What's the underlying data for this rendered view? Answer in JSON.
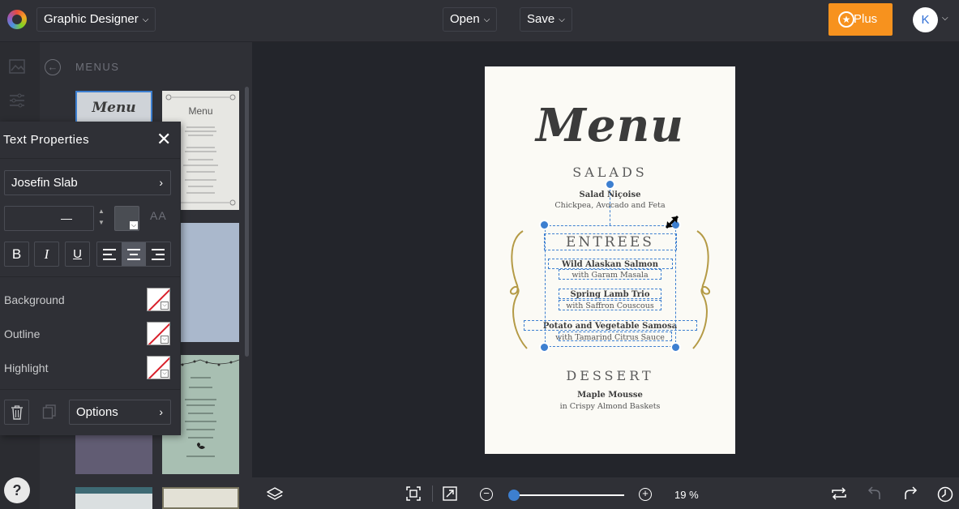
{
  "header": {
    "app_mode": "Graphic Designer",
    "open_label": "Open",
    "save_label": "Save",
    "plus_label": "Plus",
    "avatar_initial": "K"
  },
  "panel": {
    "title": "MENUS"
  },
  "text_properties": {
    "title": "Text Properties",
    "font": "Josefin Slab",
    "font_size": "—",
    "aa_label": "AA",
    "bold": "B",
    "italic": "I",
    "underline": "U",
    "background_label": "Background",
    "outline_label": "Outline",
    "highlight_label": "Highlight",
    "options_label": "Options"
  },
  "menu_design": {
    "title": "Menu",
    "salads_heading": "SALADS",
    "salad_item": "Salad Niçoise",
    "salad_desc": "Chickpea, Avocado and Feta",
    "entrees_heading": "ENTREES",
    "entree1": "Wild Alaskan Salmon",
    "entree1_desc": "with Garam Masala",
    "entree2": "Spring Lamb Trio",
    "entree2_desc": "with Saffron Couscous",
    "entree3": "Potato and Vegetable Samosa",
    "entree3_desc": "with Tamarind Citrus Sauce",
    "dessert_heading": "DESSERT",
    "dessert_item": "Maple Mousse",
    "dessert_desc": "in Crispy Almond Baskets"
  },
  "thumbnails": {
    "t1_title": "Menu",
    "t2_title": "Menu"
  },
  "bottombar": {
    "zoom": "19 %"
  },
  "colors": {
    "accent": "#f7921e",
    "selection": "#3d7fd0",
    "text_color_swatch": "#4a4d53"
  }
}
